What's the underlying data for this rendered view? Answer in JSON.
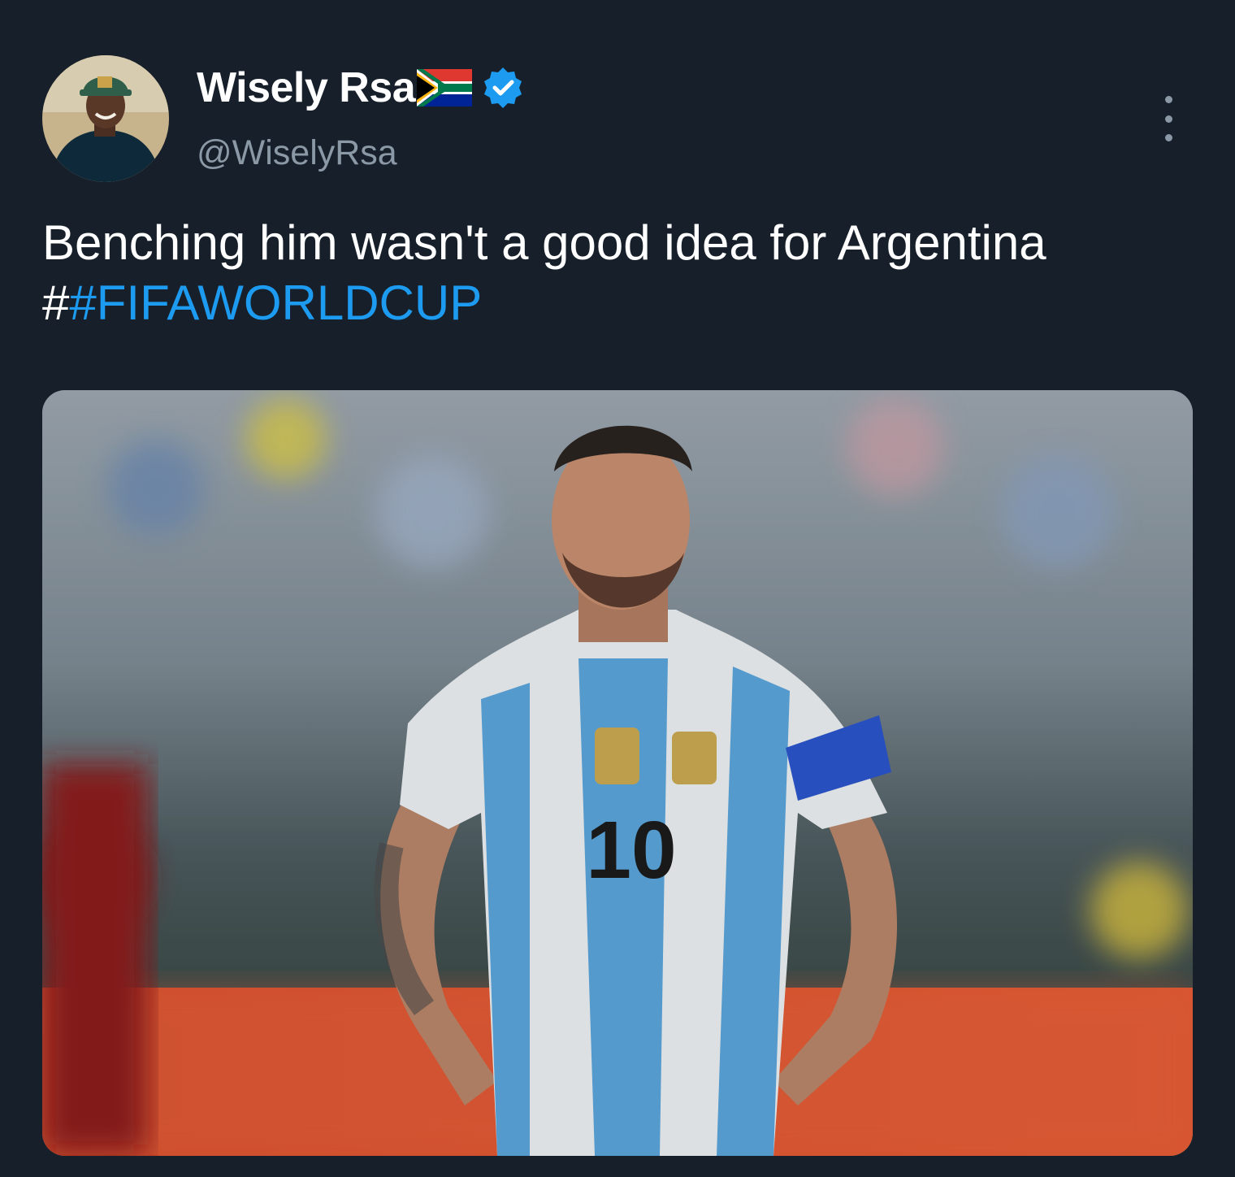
{
  "tweet": {
    "author": {
      "display_name": "Wisely Rsa",
      "handle": "@WiselyRsa",
      "verified": true,
      "flag": "south-africa-flag"
    },
    "text": "Benching him wasn't a good idea for Argentina",
    "hashtag_prefix": "#",
    "hashtag": "#FIFAWORLDCUP",
    "media": {
      "description_icon": "photo-footballer",
      "jersey_number": "10"
    },
    "more_icon": "more-options-icon"
  },
  "colors": {
    "background": "#17202a",
    "link": "#1d9bf0",
    "secondary_text": "#8b98a5",
    "verified": "#1d9bf0"
  }
}
